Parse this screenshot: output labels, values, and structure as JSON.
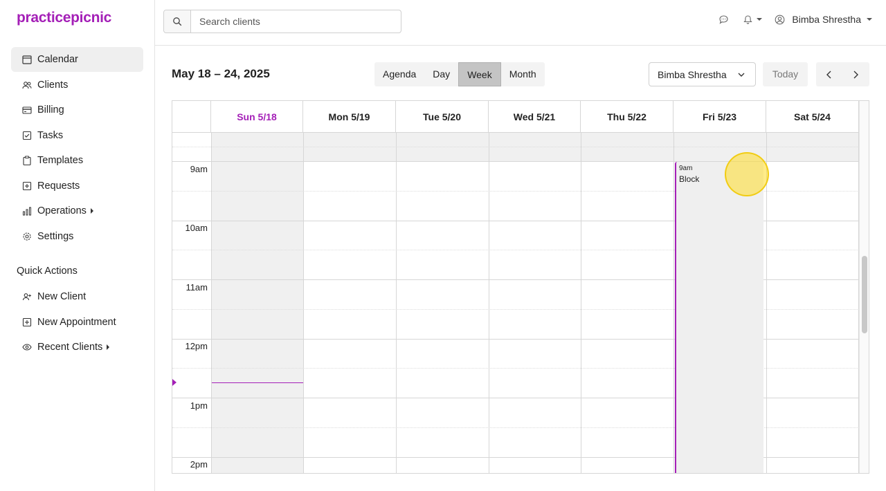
{
  "brand": {
    "logo": "practicepicnic",
    "accent_color": "#a41fb7"
  },
  "sidebar": {
    "items": [
      {
        "label": "Calendar",
        "icon": "calendar-icon",
        "active": true
      },
      {
        "label": "Clients",
        "icon": "users-icon"
      },
      {
        "label": "Billing",
        "icon": "credit-card-icon"
      },
      {
        "label": "Tasks",
        "icon": "checkbox-icon"
      },
      {
        "label": "Templates",
        "icon": "clipboard-icon"
      },
      {
        "label": "Requests",
        "icon": "plus-square-icon"
      },
      {
        "label": "Operations",
        "icon": "bar-chart-icon",
        "has_submenu": true
      },
      {
        "label": "Settings",
        "icon": "gear-icon"
      }
    ],
    "quick_actions_title": "Quick Actions",
    "quick_actions": [
      {
        "label": "New Client",
        "icon": "add-user-icon"
      },
      {
        "label": "New Appointment",
        "icon": "plus-square-icon"
      },
      {
        "label": "Recent Clients",
        "icon": "eye-icon",
        "has_submenu": true
      }
    ]
  },
  "header": {
    "search": {
      "placeholder": "Search clients",
      "value": ""
    },
    "user_name": "Bimba Shrestha"
  },
  "toolbar": {
    "range_title": "May 18 – 24, 2025",
    "views": [
      "Agenda",
      "Day",
      "Week",
      "Month"
    ],
    "active_view": "Week",
    "provider": "Bimba Shrestha",
    "today_label": "Today"
  },
  "calendar": {
    "days": [
      "Sun 5/18",
      "Mon 5/19",
      "Tue 5/20",
      "Wed 5/21",
      "Thu 5/22",
      "Fri 5/23",
      "Sat 5/24"
    ],
    "today_day": "Sun 5/18",
    "time_labels": [
      "9am",
      "10am",
      "11am",
      "12pm",
      "1pm",
      "2pm"
    ],
    "event": {
      "day": "Fri 5/23",
      "time": "9am",
      "title": "Block"
    }
  }
}
